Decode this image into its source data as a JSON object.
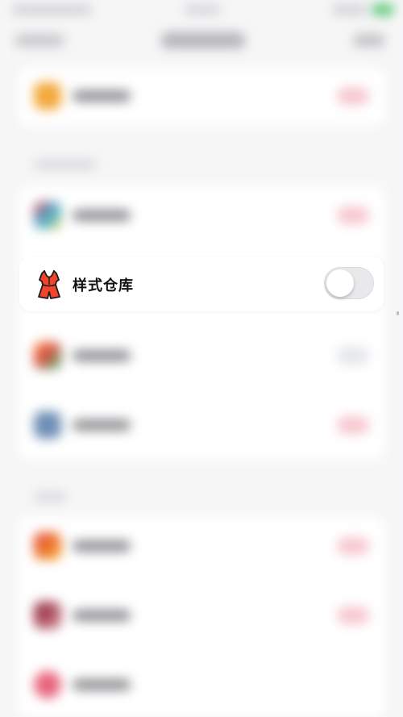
{
  "highlighted_setting": {
    "label": "样式仓库",
    "icon": "dress-icon",
    "toggle_state": "off"
  },
  "colors": {
    "icon_fill": "#F0442C",
    "icon_outline": "#1A1A1A",
    "toggle_off_track": "#E9E9EC",
    "page_background": "#F6F6F7"
  }
}
